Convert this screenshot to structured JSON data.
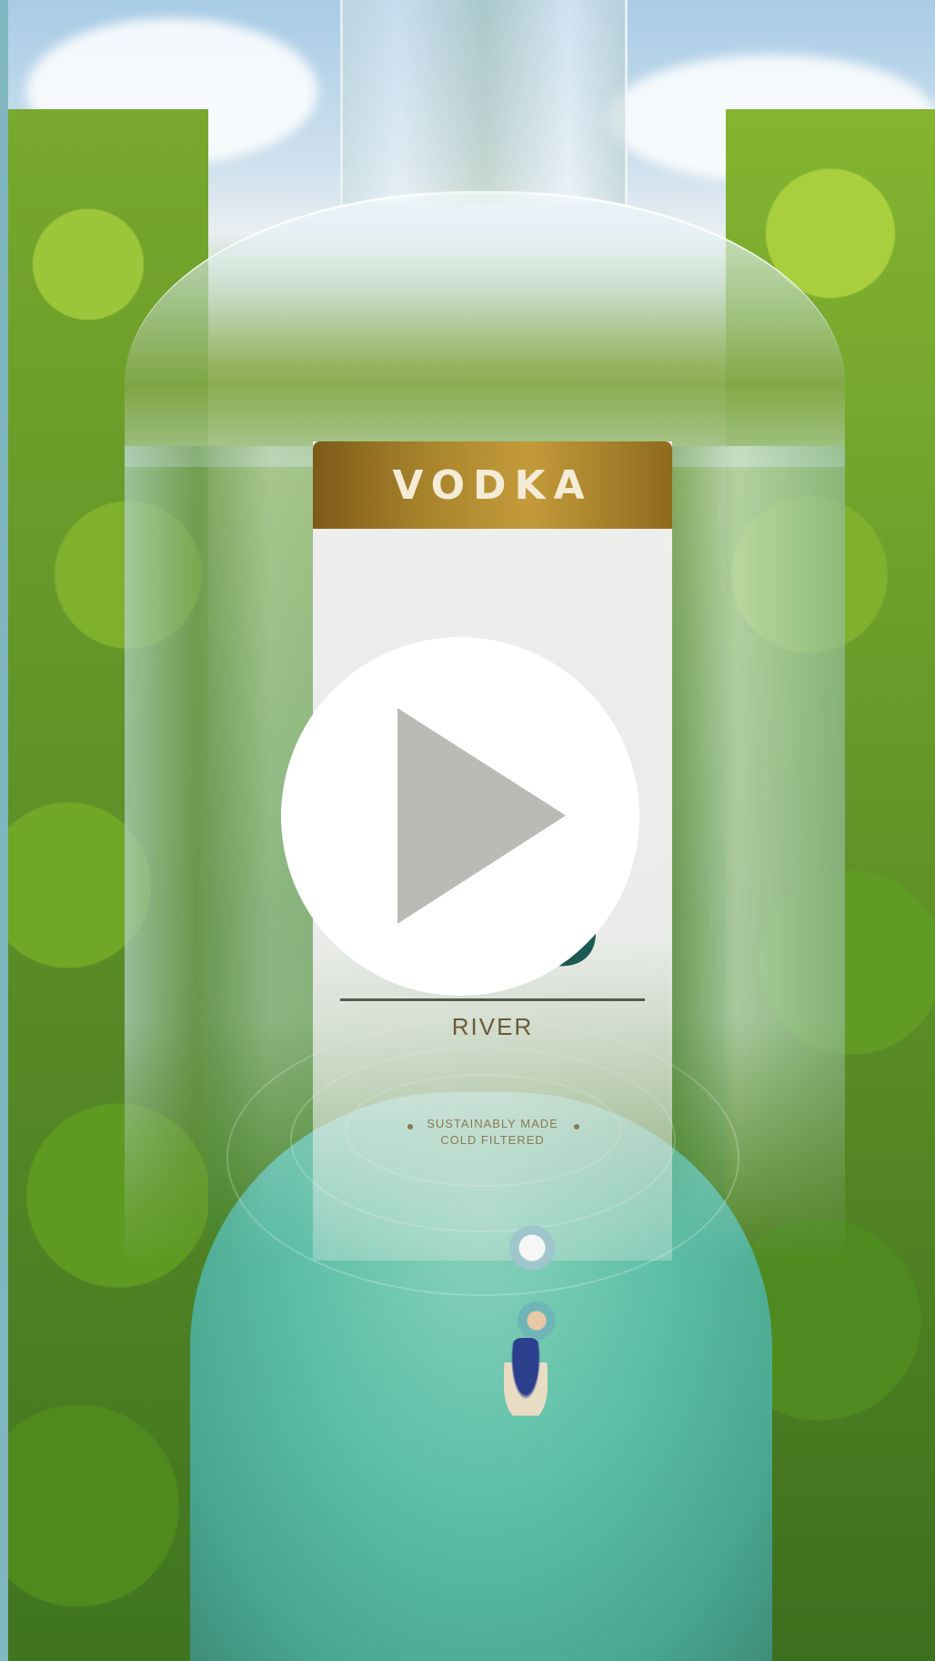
{
  "video": {
    "poster": {
      "band_text": "VODKA",
      "brand_text": "ECO",
      "sub_text": "RIVER",
      "tagline_1": "SUSTAINABLY MADE",
      "tagline_2": "COLD FILTERED"
    },
    "play_icon": "play-icon"
  },
  "colors": {
    "frame_edge": "#7fb6c0",
    "play_circle": "#ffffff",
    "play_triangle": "#bcbab7",
    "label_gold": "#a6822b",
    "brand_teal": "#1b5a52"
  }
}
